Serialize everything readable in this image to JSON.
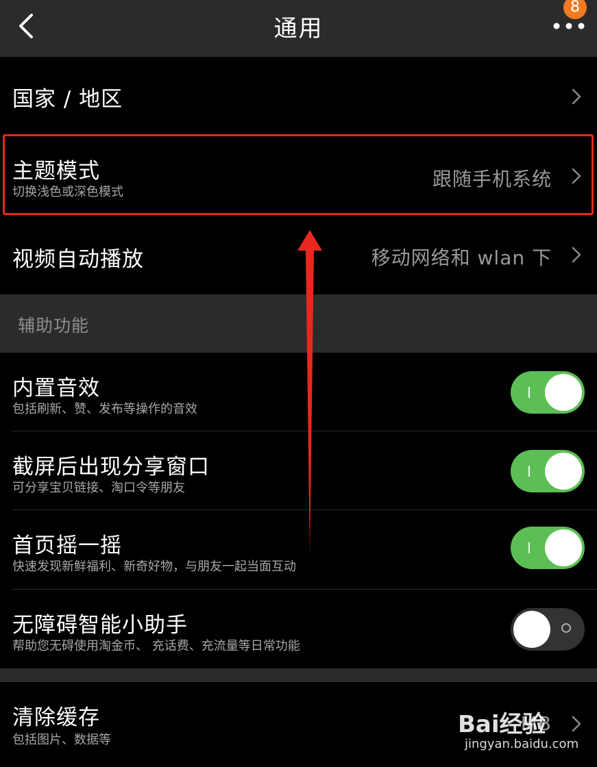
{
  "header": {
    "title": "通用",
    "badge_count": "8",
    "back_icon": "chevron-left-icon",
    "more_icon": "more-dots-icon"
  },
  "rows": {
    "region": {
      "label": "国家 / 地区"
    },
    "theme": {
      "label": "主题模式",
      "sub": "切换浅色或深色模式",
      "value": "跟随手机系统"
    },
    "autoplay": {
      "label": "视频自动播放",
      "value": "移动网络和 wlan 下"
    }
  },
  "accessibility": {
    "section_title": "辅助功能",
    "items": [
      {
        "label": "内置音效",
        "sub": "包括刷新、赞、发布等操作的音效",
        "on": true
      },
      {
        "label": "截屏后出现分享窗口",
        "sub": "可分享宝贝链接、淘口令等朋友",
        "on": true
      },
      {
        "label": "首页摇一摇",
        "sub": "快速发现新鲜福利、新奇好物，与朋友一起当面互动",
        "on": true
      },
      {
        "label": "无障碍智能小助手",
        "sub": "帮助您无碍使用淘金币、 充话费、充流量等日常功能",
        "on": false
      }
    ]
  },
  "cache": {
    "label": "清除缓存",
    "sub": "包括图片、数据等",
    "value": "MB"
  },
  "watermark": {
    "text": "Bai经验",
    "url": "jingyan.baidu.com"
  },
  "colors": {
    "accent_toggle_on": "#5cbf55",
    "badge": "#f07a22",
    "highlight": "#e8281e",
    "header_bg": "#2b2b2b"
  }
}
